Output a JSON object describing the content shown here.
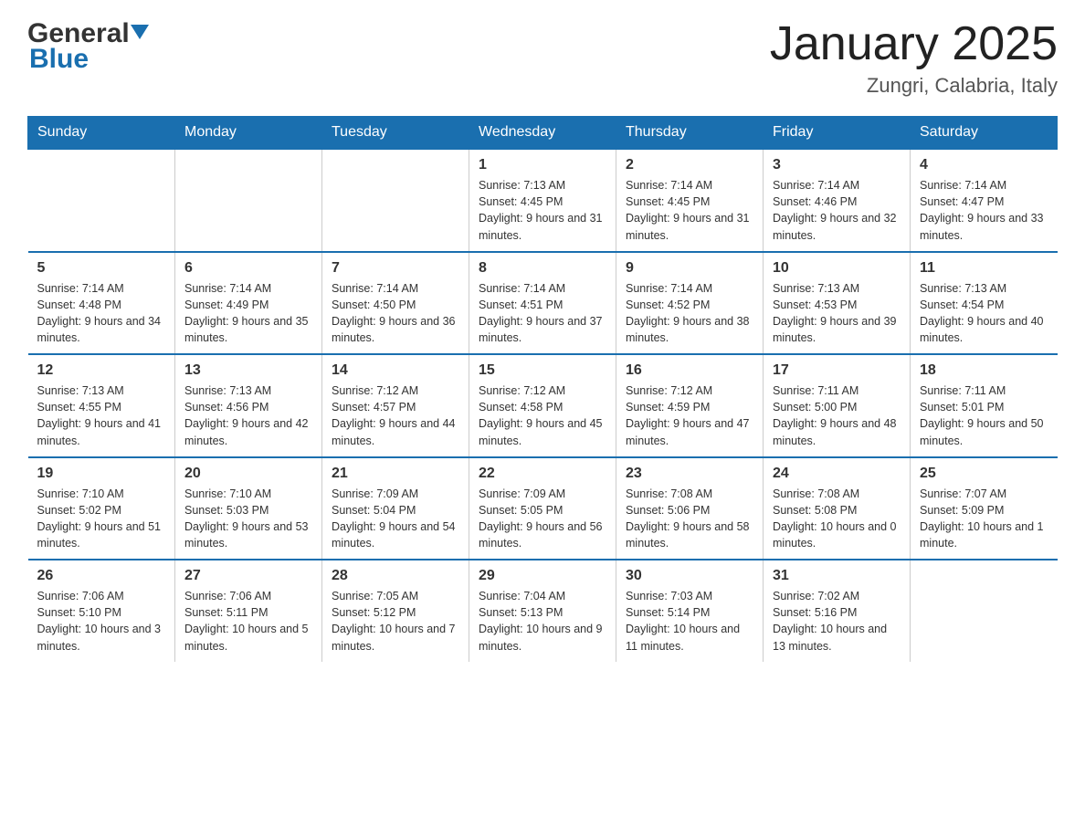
{
  "header": {
    "logo_general": "General",
    "logo_blue": "Blue",
    "month_title": "January 2025",
    "location": "Zungri, Calabria, Italy"
  },
  "calendar": {
    "weekdays": [
      "Sunday",
      "Monday",
      "Tuesday",
      "Wednesday",
      "Thursday",
      "Friday",
      "Saturday"
    ],
    "weeks": [
      [
        {
          "day": "",
          "info": ""
        },
        {
          "day": "",
          "info": ""
        },
        {
          "day": "",
          "info": ""
        },
        {
          "day": "1",
          "info": "Sunrise: 7:13 AM\nSunset: 4:45 PM\nDaylight: 9 hours and 31 minutes."
        },
        {
          "day": "2",
          "info": "Sunrise: 7:14 AM\nSunset: 4:45 PM\nDaylight: 9 hours and 31 minutes."
        },
        {
          "day": "3",
          "info": "Sunrise: 7:14 AM\nSunset: 4:46 PM\nDaylight: 9 hours and 32 minutes."
        },
        {
          "day": "4",
          "info": "Sunrise: 7:14 AM\nSunset: 4:47 PM\nDaylight: 9 hours and 33 minutes."
        }
      ],
      [
        {
          "day": "5",
          "info": "Sunrise: 7:14 AM\nSunset: 4:48 PM\nDaylight: 9 hours and 34 minutes."
        },
        {
          "day": "6",
          "info": "Sunrise: 7:14 AM\nSunset: 4:49 PM\nDaylight: 9 hours and 35 minutes."
        },
        {
          "day": "7",
          "info": "Sunrise: 7:14 AM\nSunset: 4:50 PM\nDaylight: 9 hours and 36 minutes."
        },
        {
          "day": "8",
          "info": "Sunrise: 7:14 AM\nSunset: 4:51 PM\nDaylight: 9 hours and 37 minutes."
        },
        {
          "day": "9",
          "info": "Sunrise: 7:14 AM\nSunset: 4:52 PM\nDaylight: 9 hours and 38 minutes."
        },
        {
          "day": "10",
          "info": "Sunrise: 7:13 AM\nSunset: 4:53 PM\nDaylight: 9 hours and 39 minutes."
        },
        {
          "day": "11",
          "info": "Sunrise: 7:13 AM\nSunset: 4:54 PM\nDaylight: 9 hours and 40 minutes."
        }
      ],
      [
        {
          "day": "12",
          "info": "Sunrise: 7:13 AM\nSunset: 4:55 PM\nDaylight: 9 hours and 41 minutes."
        },
        {
          "day": "13",
          "info": "Sunrise: 7:13 AM\nSunset: 4:56 PM\nDaylight: 9 hours and 42 minutes."
        },
        {
          "day": "14",
          "info": "Sunrise: 7:12 AM\nSunset: 4:57 PM\nDaylight: 9 hours and 44 minutes."
        },
        {
          "day": "15",
          "info": "Sunrise: 7:12 AM\nSunset: 4:58 PM\nDaylight: 9 hours and 45 minutes."
        },
        {
          "day": "16",
          "info": "Sunrise: 7:12 AM\nSunset: 4:59 PM\nDaylight: 9 hours and 47 minutes."
        },
        {
          "day": "17",
          "info": "Sunrise: 7:11 AM\nSunset: 5:00 PM\nDaylight: 9 hours and 48 minutes."
        },
        {
          "day": "18",
          "info": "Sunrise: 7:11 AM\nSunset: 5:01 PM\nDaylight: 9 hours and 50 minutes."
        }
      ],
      [
        {
          "day": "19",
          "info": "Sunrise: 7:10 AM\nSunset: 5:02 PM\nDaylight: 9 hours and 51 minutes."
        },
        {
          "day": "20",
          "info": "Sunrise: 7:10 AM\nSunset: 5:03 PM\nDaylight: 9 hours and 53 minutes."
        },
        {
          "day": "21",
          "info": "Sunrise: 7:09 AM\nSunset: 5:04 PM\nDaylight: 9 hours and 54 minutes."
        },
        {
          "day": "22",
          "info": "Sunrise: 7:09 AM\nSunset: 5:05 PM\nDaylight: 9 hours and 56 minutes."
        },
        {
          "day": "23",
          "info": "Sunrise: 7:08 AM\nSunset: 5:06 PM\nDaylight: 9 hours and 58 minutes."
        },
        {
          "day": "24",
          "info": "Sunrise: 7:08 AM\nSunset: 5:08 PM\nDaylight: 10 hours and 0 minutes."
        },
        {
          "day": "25",
          "info": "Sunrise: 7:07 AM\nSunset: 5:09 PM\nDaylight: 10 hours and 1 minute."
        }
      ],
      [
        {
          "day": "26",
          "info": "Sunrise: 7:06 AM\nSunset: 5:10 PM\nDaylight: 10 hours and 3 minutes."
        },
        {
          "day": "27",
          "info": "Sunrise: 7:06 AM\nSunset: 5:11 PM\nDaylight: 10 hours and 5 minutes."
        },
        {
          "day": "28",
          "info": "Sunrise: 7:05 AM\nSunset: 5:12 PM\nDaylight: 10 hours and 7 minutes."
        },
        {
          "day": "29",
          "info": "Sunrise: 7:04 AM\nSunset: 5:13 PM\nDaylight: 10 hours and 9 minutes."
        },
        {
          "day": "30",
          "info": "Sunrise: 7:03 AM\nSunset: 5:14 PM\nDaylight: 10 hours and 11 minutes."
        },
        {
          "day": "31",
          "info": "Sunrise: 7:02 AM\nSunset: 5:16 PM\nDaylight: 10 hours and 13 minutes."
        },
        {
          "day": "",
          "info": ""
        }
      ]
    ]
  }
}
